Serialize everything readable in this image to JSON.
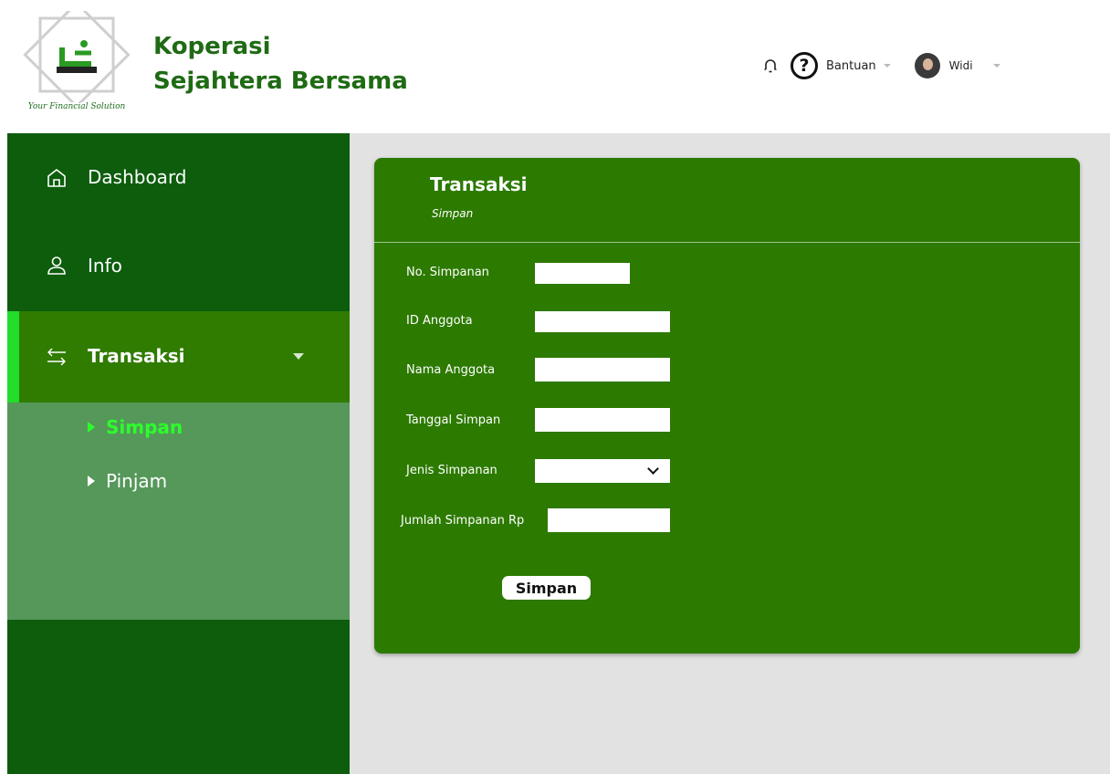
{
  "header": {
    "brand_line1": "Koperasi",
    "brand_line2": "Sejahtera Bersama",
    "logo_tagline": "Your Financial Solution",
    "help_label": "Bantuan",
    "user_name": "Widi"
  },
  "sidebar": {
    "items": [
      {
        "label": "Dashboard",
        "icon": "home-icon"
      },
      {
        "label": "Info",
        "icon": "user-icon"
      },
      {
        "label": "Transaksi",
        "icon": "transfer-arrows-icon",
        "active": true
      }
    ],
    "submenu": [
      {
        "label": "Simpan",
        "active": true
      },
      {
        "label": "Pinjam",
        "active": false
      }
    ]
  },
  "card": {
    "title": "Transaksi",
    "subtitle": "Simpan",
    "fields": {
      "no_simpanan": {
        "label": "No. Simpanan",
        "value": ""
      },
      "id_anggota": {
        "label": "ID Anggota",
        "value": ""
      },
      "nama_anggota": {
        "label": "Nama Anggota",
        "value": ""
      },
      "tanggal_simpan": {
        "label": "Tanggal Simpan",
        "value": ""
      },
      "jenis_simpanan": {
        "label": "Jenis Simpanan",
        "value": ""
      },
      "jumlah_simpanan": {
        "label": "Jumlah Simpanan Rp",
        "value": ""
      }
    },
    "submit_label": "Simpan"
  },
  "colors": {
    "brand_green": "#1f6b14",
    "sidebar_bg": "#0d5d0d",
    "active_item_bg": "#2f7c00",
    "active_indicator": "#22dd2a",
    "submenu_bg": "#55985a",
    "submenu_active_text": "#2cff2c",
    "card_bg": "#2c7a00",
    "content_bg": "#e2e2e2"
  }
}
